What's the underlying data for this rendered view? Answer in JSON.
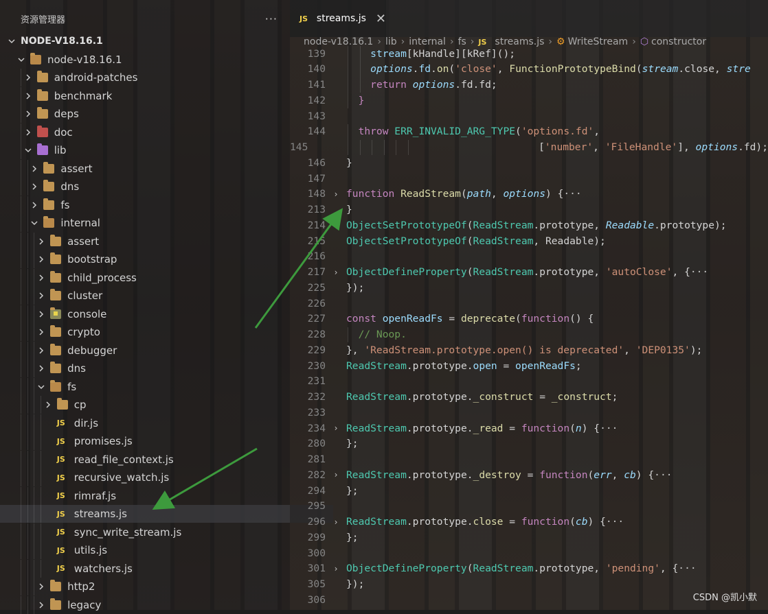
{
  "sidebar": {
    "title": "资源管理器",
    "more_label": "···",
    "root_label": "NODE-V18.16.1",
    "items": [
      {
        "label": "node-v18.16.1",
        "type": "folder-open",
        "depth": 1
      },
      {
        "label": "android-patches",
        "type": "folder",
        "depth": 2
      },
      {
        "label": "benchmark",
        "type": "folder",
        "depth": 2
      },
      {
        "label": "deps",
        "type": "folder",
        "depth": 2
      },
      {
        "label": "doc",
        "type": "folder-doc",
        "depth": 2
      },
      {
        "label": "lib",
        "type": "folder-lib-open",
        "depth": 2
      },
      {
        "label": "assert",
        "type": "folder",
        "depth": 3
      },
      {
        "label": "dns",
        "type": "folder",
        "depth": 3
      },
      {
        "label": "fs",
        "type": "folder",
        "depth": 3
      },
      {
        "label": "internal",
        "type": "folder-open",
        "depth": 3
      },
      {
        "label": "assert",
        "type": "folder",
        "depth": 4
      },
      {
        "label": "bootstrap",
        "type": "folder",
        "depth": 4
      },
      {
        "label": "child_process",
        "type": "folder",
        "depth": 4
      },
      {
        "label": "cluster",
        "type": "folder",
        "depth": 4
      },
      {
        "label": "console",
        "type": "folder-console",
        "depth": 4
      },
      {
        "label": "crypto",
        "type": "folder",
        "depth": 4
      },
      {
        "label": "debugger",
        "type": "folder",
        "depth": 4
      },
      {
        "label": "dns",
        "type": "folder",
        "depth": 4
      },
      {
        "label": "fs",
        "type": "folder-open",
        "depth": 4
      },
      {
        "label": "cp",
        "type": "folder",
        "depth": 5
      },
      {
        "label": "dir.js",
        "type": "js",
        "depth": 5
      },
      {
        "label": "promises.js",
        "type": "js",
        "depth": 5
      },
      {
        "label": "read_file_context.js",
        "type": "js",
        "depth": 5
      },
      {
        "label": "recursive_watch.js",
        "type": "js",
        "depth": 5
      },
      {
        "label": "rimraf.js",
        "type": "js",
        "depth": 5
      },
      {
        "label": "streams.js",
        "type": "js",
        "depth": 5,
        "selected": true
      },
      {
        "label": "sync_write_stream.js",
        "type": "js",
        "depth": 5
      },
      {
        "label": "utils.js",
        "type": "js",
        "depth": 5
      },
      {
        "label": "watchers.js",
        "type": "js",
        "depth": 5
      },
      {
        "label": "http2",
        "type": "folder",
        "depth": 4
      },
      {
        "label": "legacy",
        "type": "folder",
        "depth": 4
      }
    ]
  },
  "tab": {
    "icon": "JS",
    "label": "streams.js",
    "close": "✕"
  },
  "breadcrumb": [
    "node-v18.16.1",
    "lib",
    "internal",
    "fs",
    "streams.js",
    "WriteStream",
    "constructor"
  ],
  "code_lines": [
    {
      "n": "139",
      "fold": false,
      "indent": 2,
      "tokens": [
        [
          "obj",
          "stream"
        ],
        [
          "txt",
          "[kHandle][kRef]();"
        ]
      ]
    },
    {
      "n": "140",
      "fold": false,
      "indent": 2,
      "tokens": [
        [
          "param",
          "options"
        ],
        [
          "txt",
          "."
        ],
        [
          "obj",
          "fd"
        ],
        [
          "txt",
          "."
        ],
        [
          "fn",
          "on"
        ],
        [
          "txt",
          "("
        ],
        [
          "str",
          "'close'"
        ],
        [
          "txt",
          ", "
        ],
        [
          "fn",
          "FunctionPrototypeBind"
        ],
        [
          "txt",
          "("
        ],
        [
          "param",
          "stream"
        ],
        [
          "txt",
          ".close, "
        ],
        [
          "param",
          "stre"
        ]
      ]
    },
    {
      "n": "141",
      "fold": false,
      "indent": 2,
      "tokens": [
        [
          "kw",
          "return "
        ],
        [
          "param",
          "options"
        ],
        [
          "txt",
          ".fd.fd;"
        ]
      ]
    },
    {
      "n": "142",
      "fold": false,
      "indent": 1,
      "tokens": [
        [
          "kw",
          "}"
        ]
      ]
    },
    {
      "n": "143",
      "fold": false,
      "indent": 0,
      "tokens": []
    },
    {
      "n": "144",
      "fold": false,
      "indent": 1,
      "tokens": [
        [
          "kw",
          "throw "
        ],
        [
          "cls",
          "ERR_INVALID_ARG_TYPE"
        ],
        [
          "txt",
          "("
        ],
        [
          "str",
          "'options.fd'"
        ],
        [
          "txt",
          ","
        ]
      ]
    },
    {
      "n": "145",
      "fold": false,
      "indent": 7,
      "tokens": [
        [
          "txt",
          "                  ["
        ],
        [
          "str",
          "'number'"
        ],
        [
          "txt",
          ", "
        ],
        [
          "str",
          "'FileHandle'"
        ],
        [
          "txt",
          "], "
        ],
        [
          "param",
          "options"
        ],
        [
          "txt",
          ".fd);"
        ]
      ]
    },
    {
      "n": "146",
      "fold": false,
      "indent": 0,
      "tokens": [
        [
          "txt",
          "}"
        ]
      ]
    },
    {
      "n": "147",
      "fold": false,
      "indent": 0,
      "tokens": []
    },
    {
      "n": "148",
      "fold": true,
      "indent": 0,
      "tokens": [
        [
          "kw",
          "function "
        ],
        [
          "fn",
          "ReadStream"
        ],
        [
          "txt",
          "("
        ],
        [
          "param",
          "path"
        ],
        [
          "txt",
          ", "
        ],
        [
          "param",
          "options"
        ],
        [
          "txt",
          ") {"
        ],
        [
          "ellip",
          "···"
        ]
      ]
    },
    {
      "n": "213",
      "fold": false,
      "indent": 0,
      "tokens": [
        [
          "txt",
          "}"
        ]
      ]
    },
    {
      "n": "214",
      "fold": false,
      "indent": 0,
      "tokens": [
        [
          "cls",
          "ObjectSetPrototypeOf"
        ],
        [
          "txt",
          "("
        ],
        [
          "cls",
          "ReadStream"
        ],
        [
          "txt",
          ".prototype, "
        ],
        [
          "param",
          "Readable"
        ],
        [
          "txt",
          ".prototype);"
        ]
      ]
    },
    {
      "n": "215",
      "fold": false,
      "indent": 0,
      "tokens": [
        [
          "cls",
          "ObjectSetPrototypeOf"
        ],
        [
          "txt",
          "("
        ],
        [
          "cls",
          "ReadStream"
        ],
        [
          "txt",
          ", Readable);"
        ]
      ]
    },
    {
      "n": "216",
      "fold": false,
      "indent": 0,
      "tokens": []
    },
    {
      "n": "217",
      "fold": true,
      "indent": 0,
      "tokens": [
        [
          "cls",
          "ObjectDefineProperty"
        ],
        [
          "txt",
          "("
        ],
        [
          "cls",
          "ReadStream"
        ],
        [
          "txt",
          ".prototype, "
        ],
        [
          "str",
          "'autoClose'"
        ],
        [
          "txt",
          ", {"
        ],
        [
          "ellip",
          "···"
        ]
      ]
    },
    {
      "n": "225",
      "fold": false,
      "indent": 0,
      "tokens": [
        [
          "txt",
          "});"
        ]
      ]
    },
    {
      "n": "226",
      "fold": false,
      "indent": 0,
      "tokens": []
    },
    {
      "n": "227",
      "fold": false,
      "indent": 0,
      "tokens": [
        [
          "kw",
          "const "
        ],
        [
          "obj",
          "openReadFs"
        ],
        [
          "txt",
          " = "
        ],
        [
          "fn",
          "deprecate"
        ],
        [
          "txt",
          "("
        ],
        [
          "kw",
          "function"
        ],
        [
          "txt",
          "() {"
        ]
      ]
    },
    {
      "n": "228",
      "fold": false,
      "indent": 1,
      "tokens": [
        [
          "cmt",
          "// Noop."
        ]
      ]
    },
    {
      "n": "229",
      "fold": false,
      "indent": 0,
      "tokens": [
        [
          "txt",
          "}, "
        ],
        [
          "str",
          "'ReadStream.prototype.open() is deprecated'"
        ],
        [
          "txt",
          ", "
        ],
        [
          "str",
          "'DEP0135'"
        ],
        [
          "txt",
          ");"
        ]
      ]
    },
    {
      "n": "230",
      "fold": false,
      "indent": 0,
      "tokens": [
        [
          "cls",
          "ReadStream"
        ],
        [
          "txt",
          ".prototype."
        ],
        [
          "obj",
          "open"
        ],
        [
          "txt",
          " = "
        ],
        [
          "obj",
          "openReadFs"
        ],
        [
          "txt",
          ";"
        ]
      ]
    },
    {
      "n": "231",
      "fold": false,
      "indent": 0,
      "tokens": []
    },
    {
      "n": "232",
      "fold": false,
      "indent": 0,
      "tokens": [
        [
          "cls",
          "ReadStream"
        ],
        [
          "txt",
          ".prototype."
        ],
        [
          "fn",
          "_construct"
        ],
        [
          "txt",
          " = "
        ],
        [
          "fn",
          "_construct"
        ],
        [
          "txt",
          ";"
        ]
      ]
    },
    {
      "n": "233",
      "fold": false,
      "indent": 0,
      "tokens": []
    },
    {
      "n": "234",
      "fold": true,
      "indent": 0,
      "tokens": [
        [
          "cls",
          "ReadStream"
        ],
        [
          "txt",
          ".prototype."
        ],
        [
          "fn",
          "_read"
        ],
        [
          "txt",
          " = "
        ],
        [
          "kw",
          "function"
        ],
        [
          "txt",
          "("
        ],
        [
          "param",
          "n"
        ],
        [
          "txt",
          ") {"
        ],
        [
          "ellip",
          "···"
        ]
      ]
    },
    {
      "n": "280",
      "fold": false,
      "indent": 0,
      "tokens": [
        [
          "txt",
          "};"
        ]
      ]
    },
    {
      "n": "281",
      "fold": false,
      "indent": 0,
      "tokens": []
    },
    {
      "n": "282",
      "fold": true,
      "indent": 0,
      "tokens": [
        [
          "cls",
          "ReadStream"
        ],
        [
          "txt",
          ".prototype."
        ],
        [
          "fn",
          "_destroy"
        ],
        [
          "txt",
          " = "
        ],
        [
          "kw",
          "function"
        ],
        [
          "txt",
          "("
        ],
        [
          "param",
          "err"
        ],
        [
          "txt",
          ", "
        ],
        [
          "param",
          "cb"
        ],
        [
          "txt",
          ") {"
        ],
        [
          "ellip",
          "···"
        ]
      ]
    },
    {
      "n": "294",
      "fold": false,
      "indent": 0,
      "tokens": [
        [
          "txt",
          "};"
        ]
      ]
    },
    {
      "n": "295",
      "fold": false,
      "indent": 0,
      "tokens": []
    },
    {
      "n": "296",
      "fold": true,
      "indent": 0,
      "tokens": [
        [
          "cls",
          "ReadStream"
        ],
        [
          "txt",
          ".prototype."
        ],
        [
          "fn",
          "close"
        ],
        [
          "txt",
          " = "
        ],
        [
          "kw",
          "function"
        ],
        [
          "txt",
          "("
        ],
        [
          "param",
          "cb"
        ],
        [
          "txt",
          ") {"
        ],
        [
          "ellip",
          "···"
        ]
      ]
    },
    {
      "n": "299",
      "fold": false,
      "indent": 0,
      "tokens": [
        [
          "txt",
          "};"
        ]
      ]
    },
    {
      "n": "300",
      "fold": false,
      "indent": 0,
      "tokens": []
    },
    {
      "n": "301",
      "fold": true,
      "indent": 0,
      "tokens": [
        [
          "cls",
          "ObjectDefineProperty"
        ],
        [
          "txt",
          "("
        ],
        [
          "cls",
          "ReadStream"
        ],
        [
          "txt",
          ".prototype, "
        ],
        [
          "str",
          "'pending'"
        ],
        [
          "txt",
          ", {"
        ],
        [
          "ellip",
          "···"
        ]
      ]
    },
    {
      "n": "305",
      "fold": false,
      "indent": 0,
      "tokens": [
        [
          "txt",
          "});"
        ]
      ]
    },
    {
      "n": "306",
      "fold": false,
      "indent": 0,
      "tokens": []
    }
  ],
  "watermark": "CSDN @凯小默",
  "colors": {
    "arrow": "#3d9a3d",
    "js_icon": "#f1d04b",
    "folder": "#c09553"
  }
}
